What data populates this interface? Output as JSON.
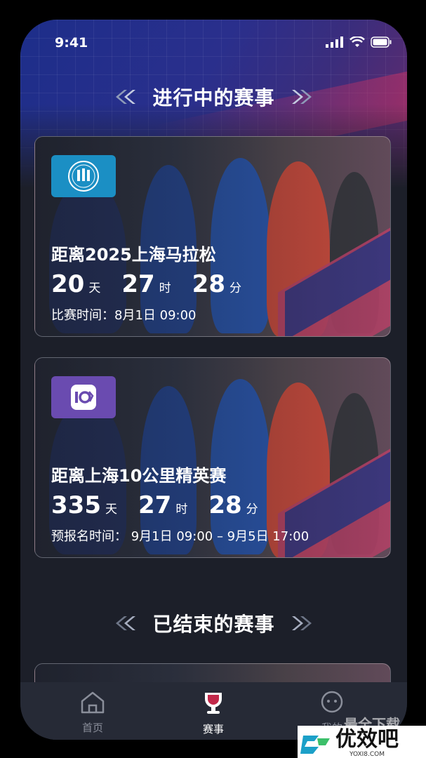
{
  "status_bar": {
    "time": "9:41"
  },
  "sections": {
    "ongoing_title": "进行中的赛事",
    "finished_title": "已结束的赛事"
  },
  "cards": [
    {
      "title": "距离2025上海马拉松",
      "days": "20",
      "days_unit": "天",
      "hours": "27",
      "hours_unit": "时",
      "minutes": "28",
      "minutes_unit": "分",
      "time_text": "比赛时间：8月1日  09:00",
      "logo_color": "#1b8fc4"
    },
    {
      "title": "距离上海10公里精英赛",
      "days": "335",
      "days_unit": "天",
      "hours": "27",
      "hours_unit": "时",
      "minutes": "28",
      "minutes_unit": "分",
      "time_text": "预报名时间：  9月1日   09:00 – 9月5日  17:00",
      "logo_color": "#6a4bb0"
    }
  ],
  "tabbar": {
    "items": [
      {
        "label": "首页",
        "icon": "home-icon",
        "active": false
      },
      {
        "label": "赛事",
        "icon": "trophy-icon",
        "active": true
      },
      {
        "label": "我的",
        "icon": "profile-icon",
        "active": false
      }
    ],
    "active_color": "#ffffff",
    "inactive_color": "#8a8e9a"
  },
  "watermark": {
    "text": "优效吧",
    "sub": "YOXI8.COM",
    "overlay": "最全下载"
  }
}
